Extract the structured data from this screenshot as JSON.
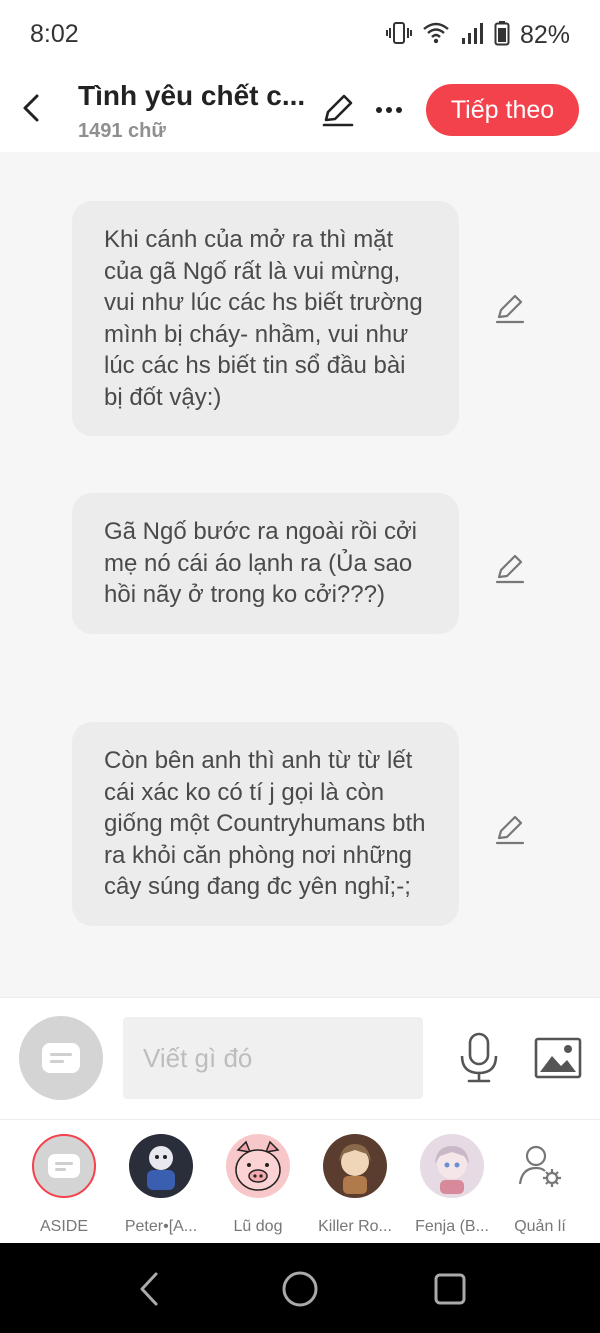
{
  "status": {
    "time": "8:02",
    "battery": "82%"
  },
  "header": {
    "title": "Tình yêu chết c...",
    "word_count": "1491 chữ",
    "next_label": "Tiếp theo",
    "accent": "#f4424c"
  },
  "messages": [
    {
      "text": "Khi cánh của mở ra thì mặt của gã Ngố rất là vui mừng, vui như lúc các hs biết trường mình bị cháy- nhầm, vui như lúc các hs biết tin sổ đầu bài bị đốt vậy:)"
    },
    {
      "text": "Gã Ngố bước ra ngoài rồi cởi mẹ nó cái áo lạnh ra (Ủa sao hồi nãy ở trong ko cởi???)"
    },
    {
      "text": "Còn bên anh thì anh từ từ lết cái xác ko có tí j gọi là còn giống một Countryhumans bth ra khỏi căn phòng nơi những cây súng đang đc yên nghỉ;-;"
    }
  ],
  "composer": {
    "placeholder": "Viết gì đó"
  },
  "characters": [
    {
      "name": "ASIDE"
    },
    {
      "name": "Peter•[A..."
    },
    {
      "name": "Lũ dog"
    },
    {
      "name": "Killer Ro..."
    },
    {
      "name": "Fenja (B..."
    },
    {
      "name": "Quản lí"
    }
  ]
}
